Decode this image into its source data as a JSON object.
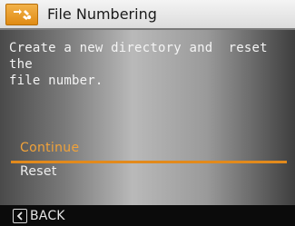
{
  "header": {
    "title": "File Numbering"
  },
  "dialog": {
    "message": "Create a new directory and  reset the\nfile number."
  },
  "options": [
    {
      "label": "Continue",
      "selected": true
    },
    {
      "label": "Reset",
      "selected": false
    }
  ],
  "footer": {
    "back_label": "BACK"
  },
  "colors": {
    "accent": "#e28a1c",
    "selected_text": "#f0a23a",
    "title_bar": "#e6e6e6",
    "footer": "#0b0b0b"
  },
  "icons": {
    "menu": "wrench-menu-icon",
    "back": "back-arrow-icon"
  }
}
